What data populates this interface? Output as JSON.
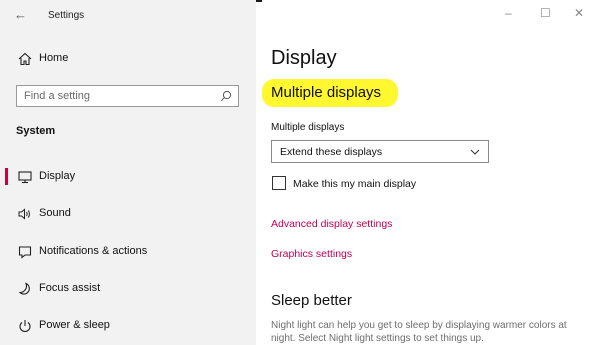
{
  "window": {
    "title": "Settings",
    "back_icon": "back-arrow-icon",
    "minimize": "–",
    "maximize": "☐",
    "close": "✕"
  },
  "sidebar": {
    "home_label": "Home",
    "search_placeholder": "Find a setting",
    "section": "System",
    "items": [
      {
        "label": "Display",
        "icon": "monitor-icon",
        "selected": true
      },
      {
        "label": "Sound",
        "icon": "speaker-icon"
      },
      {
        "label": "Notifications & actions",
        "icon": "notifications-icon"
      },
      {
        "label": "Focus assist",
        "icon": "moon-icon"
      },
      {
        "label": "Power & sleep",
        "icon": "power-icon"
      }
    ],
    "accent": "#c9003b"
  },
  "main": {
    "page_title": "Display",
    "section_heading": "Multiple displays",
    "highlight_color": "#fff730",
    "multiple_displays_label": "Multiple displays",
    "dropdown_value": "Extend these displays",
    "checkbox_label": "Make this my main display",
    "checkbox_checked": false,
    "links": [
      "Advanced display settings",
      "Graphics settings"
    ],
    "link_color": "#c30052",
    "sleep_heading": "Sleep better",
    "sleep_text": "Night light can help you get to sleep by displaying warmer colors at night. Select Night light settings to set things up."
  }
}
